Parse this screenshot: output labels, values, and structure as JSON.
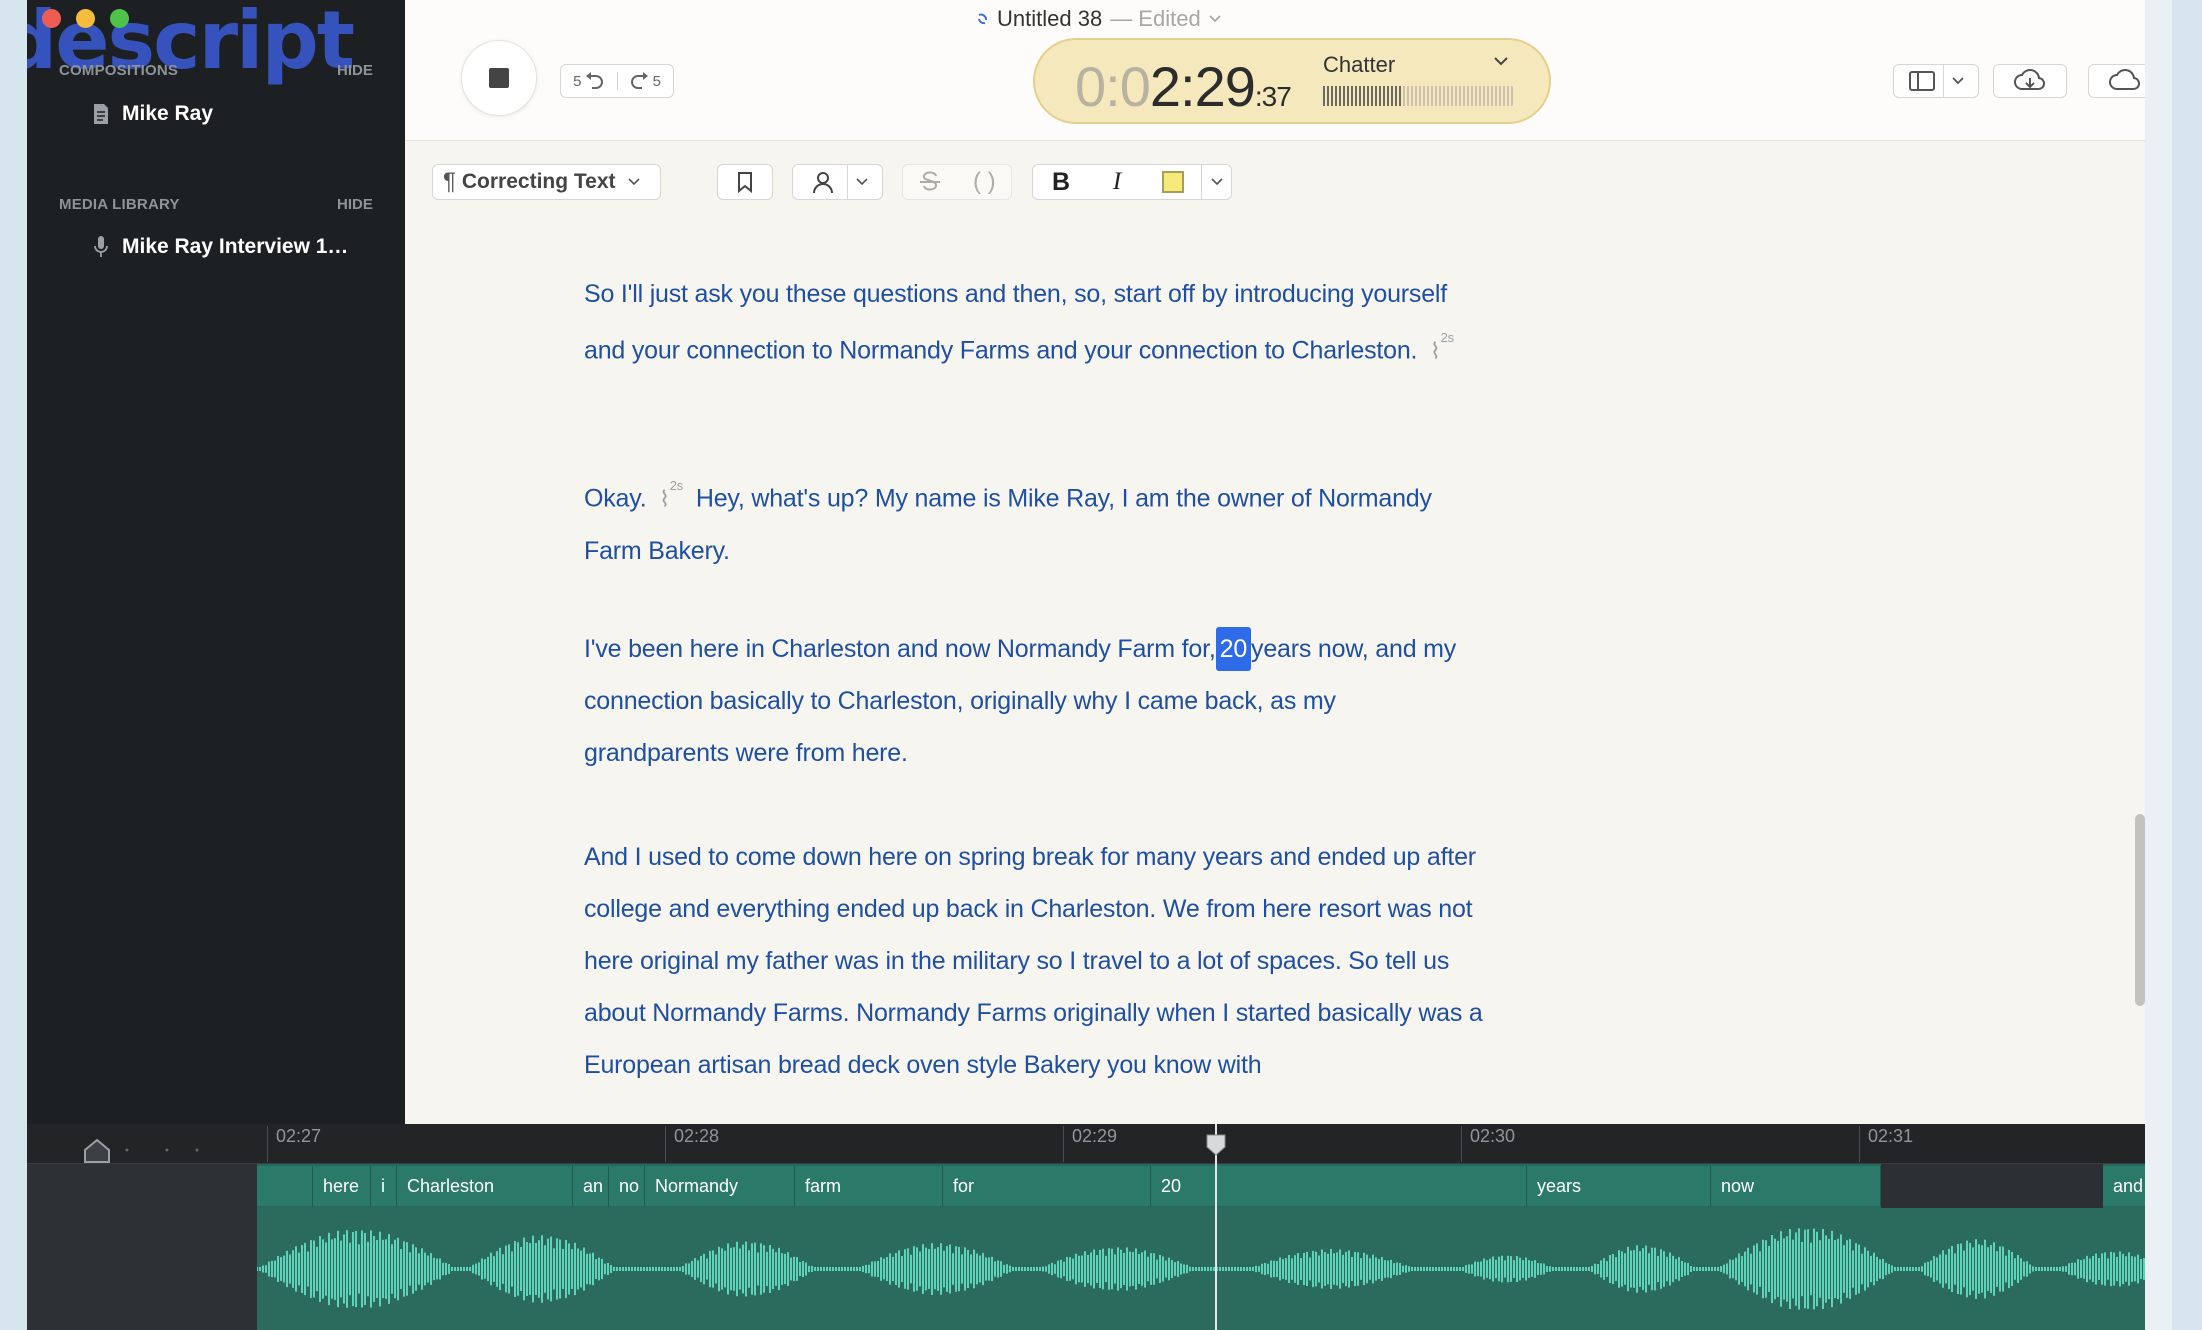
{
  "app": {
    "logo_text": "descript",
    "doc_title": "Untitled 38",
    "doc_status": "— Edited",
    "colors": {
      "accent": "#2d6be8",
      "transcript_text": "#1f4fa0",
      "timer_bg": "#f6e8bd",
      "sidebar_bg": "#1d2023",
      "waveform": "#5fd3b9"
    }
  },
  "sidebar": {
    "compositions_label": "COMPOSITIONS",
    "compositions_hide": "HIDE",
    "composition_item": "Mike Ray",
    "media_label": "MEDIA LIBRARY",
    "media_hide": "HIDE",
    "media_item": "Mike Ray Interview 1…"
  },
  "transport": {
    "skip_back": "5",
    "skip_forward": "5",
    "time_dim": "0:0",
    "time_main": "2:29",
    "time_frames": ":37",
    "voice": "Chatter",
    "level": 0.41
  },
  "toolbar": {
    "style_label": "Correcting Text",
    "bold": "B",
    "italic": "I"
  },
  "transcript": {
    "p1": {
      "text": "So I'll just ask you these questions and then, so, start off by introducing yourself and your connection to Normandy Farms and your connection to Charleston.",
      "pause": "2s"
    },
    "p2": {
      "before": "Okay.",
      "pause": "2s",
      "after": "Hey, what's up? My name is Mike Ray, I am the owner of Normandy Farm Bakery."
    },
    "p3": {
      "before": "I've been here in Charleston and now Normandy Farm for,",
      "highlight": "20",
      "after": "years now, and my connection basically to Charleston, originally why I came back, as my grandparents were from here."
    },
    "p4": {
      "text": "And I used to come down here on spring break for many years and ended up after college and everything ended up back in Charleston. We from here resort was not here original my father was in the military so I travel to a lot of spaces. So tell us about Normandy Farms. Normandy Farms originally when I started basically was a European artisan bread deck oven style Bakery you know with"
    }
  },
  "timeline": {
    "ticks": [
      "02:27",
      "02:28",
      "02:29",
      "02:30",
      "02:31"
    ],
    "words": [
      "here",
      "i",
      "Charleston",
      "an",
      "no",
      "Normandy",
      "farm",
      "for",
      "20",
      "years",
      "now",
      "and"
    ]
  }
}
